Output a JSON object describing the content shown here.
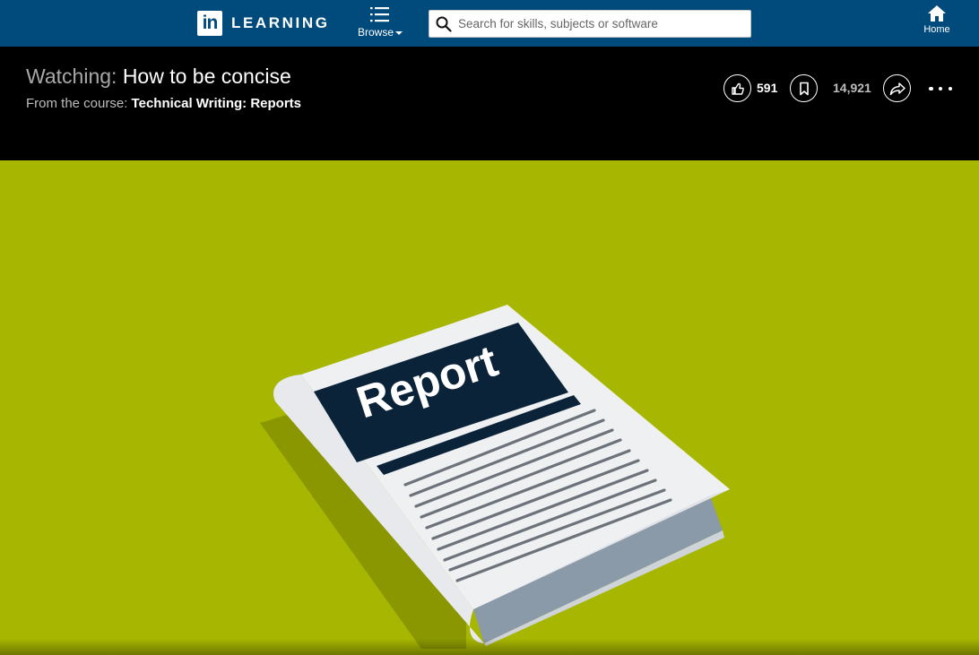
{
  "nav": {
    "logo_mark": "in",
    "logo_text": "LEARNING",
    "browse_label": "Browse",
    "search_placeholder": "Search for skills, subjects or software",
    "home_label": "Home"
  },
  "header": {
    "title_prefix": "Watching:",
    "title": "How to be concise",
    "subtitle_prefix": "From the course:",
    "course_name": "Technical Writing: Reports",
    "like_count": "591",
    "saved_count": "14,921"
  },
  "video": {
    "book_title": "Report"
  },
  "colors": {
    "nav_bg": "#004b7c",
    "header_bg": "#000000",
    "video_bg": "#a7b600",
    "book_label_bg": "#0b2339"
  },
  "icons": [
    "browse-list-icon",
    "search-icon",
    "home-icon",
    "like-icon",
    "bookmark-icon",
    "share-icon",
    "more-options-icon"
  ]
}
